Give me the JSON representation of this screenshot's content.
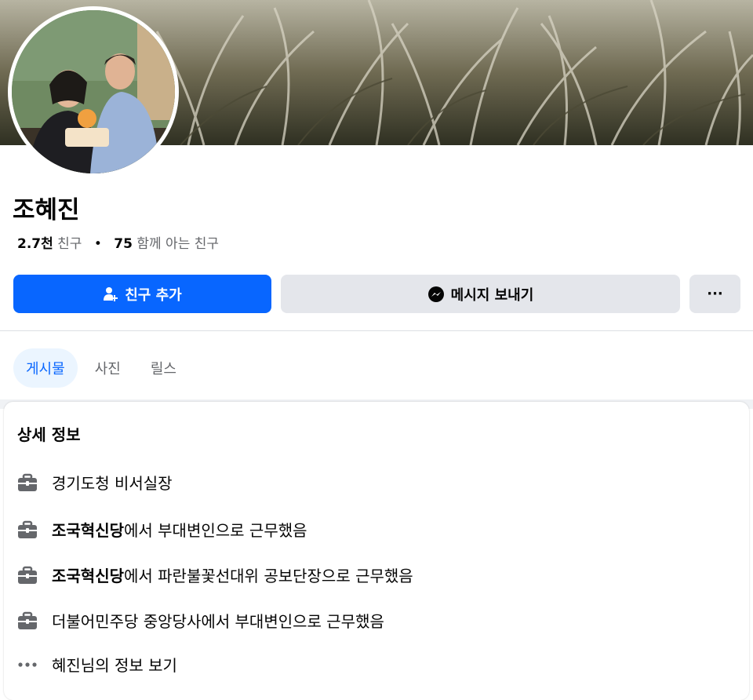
{
  "profile": {
    "name": "조혜진",
    "friends_count": "2.7천",
    "friends_label": "친구",
    "mutual_count": "75",
    "mutual_label": "함께 아는 친구"
  },
  "actions": {
    "add_friend": "친구 추가",
    "message": "메시지 보내기",
    "more": "···"
  },
  "tabs": [
    {
      "label": "게시물",
      "active": true
    },
    {
      "label": "사진",
      "active": false
    },
    {
      "label": "릴스",
      "active": false
    }
  ],
  "details": {
    "title": "상세 정보",
    "items": [
      {
        "icon": "briefcase-icon",
        "bold": "",
        "text": "경기도청 비서실장"
      },
      {
        "icon": "briefcase-icon",
        "bold": "조국혁신당",
        "text": "에서 부대변인으로 근무했음"
      },
      {
        "icon": "briefcase-icon",
        "bold": "조국혁신당",
        "text": "에서 파란불꽃선대위 공보단장으로 근무했음"
      },
      {
        "icon": "briefcase-icon",
        "bold": "",
        "text": "더불어민주당 중앙당사에서 부대변인으로 근무했음"
      },
      {
        "icon": "more-dots-icon",
        "bold": "",
        "text": "혜진님의 정보 보기"
      }
    ]
  },
  "colors": {
    "accent": "#0866ff",
    "button_gray": "#e4e6eb",
    "secondary_text": "#65676b",
    "tab_active_bg": "#ebf5ff"
  }
}
